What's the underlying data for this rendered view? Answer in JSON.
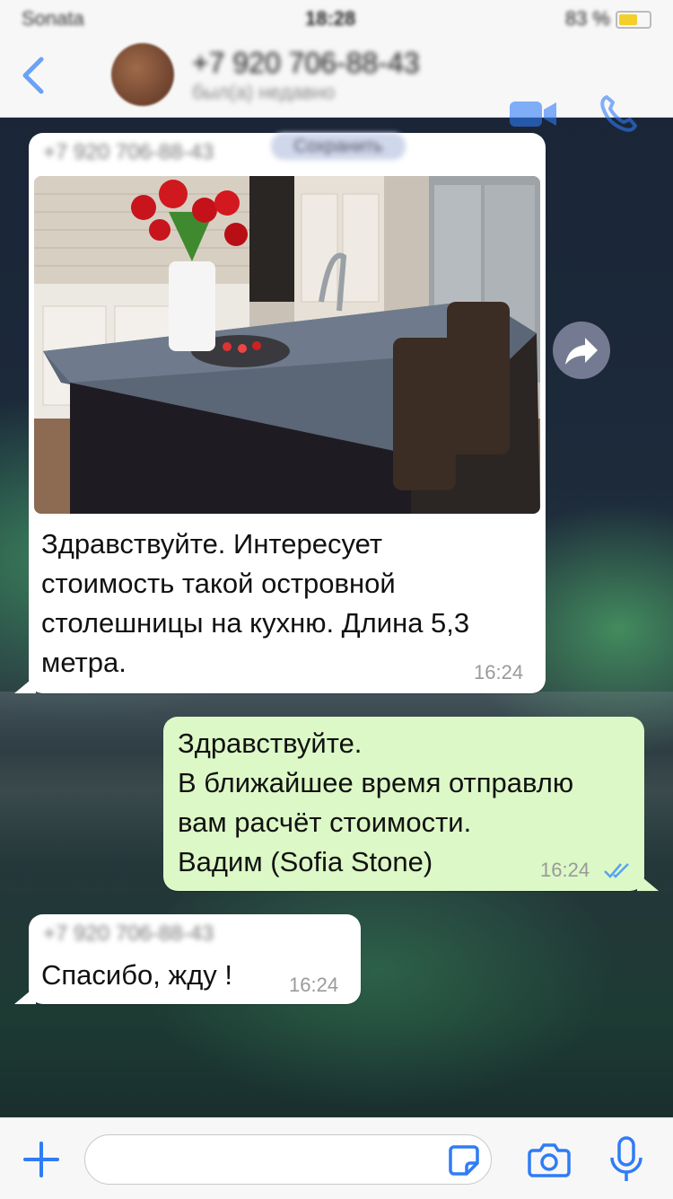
{
  "status_bar": {
    "carrier": "Sonata",
    "time": "18:28",
    "battery": "83 %",
    "battery_color": "#f4cf2a"
  },
  "header": {
    "contact_name": "+7 920 706-88-43",
    "contact_subtitle": "был(а) недавно",
    "back_icon": "chevron-left-icon",
    "video_icon": "video-camera-icon",
    "call_icon": "phone-icon"
  },
  "messages": [
    {
      "direction": "incoming",
      "sender": "+7 920 706-88-43",
      "sender_badge": "Сохранить",
      "has_image": true,
      "image_description_icon": "kitchen-island-photo",
      "text_lines": [
        "Здравствуйте. Интересует",
        "стоимость такой островной",
        "столешницы на кухню. Длина 5,3",
        "метра."
      ],
      "time": "16:24"
    },
    {
      "direction": "outgoing",
      "text_lines": [
        "Здравствуйте.",
        "В ближайшее время отправлю",
        "вам расчёт стоимости.",
        "Вадим (Sofia Stone)"
      ],
      "time": "16:24",
      "status_icon": "double-check-read-icon"
    },
    {
      "direction": "incoming",
      "sender": "+7 920 706-88-43",
      "text_lines": [
        "Спасибо, жду !"
      ],
      "time": "16:24"
    }
  ],
  "composer": {
    "placeholder": "",
    "plus_icon": "plus-icon",
    "sticker_icon": "sticker-icon",
    "camera_icon": "camera-icon",
    "mic_icon": "microphone-icon"
  },
  "colors": {
    "accent": "#2f7cf6",
    "outgoing_bubble": "#dcf8c6",
    "incoming_bubble": "#ffffff",
    "read_check": "#5aa2f0"
  }
}
